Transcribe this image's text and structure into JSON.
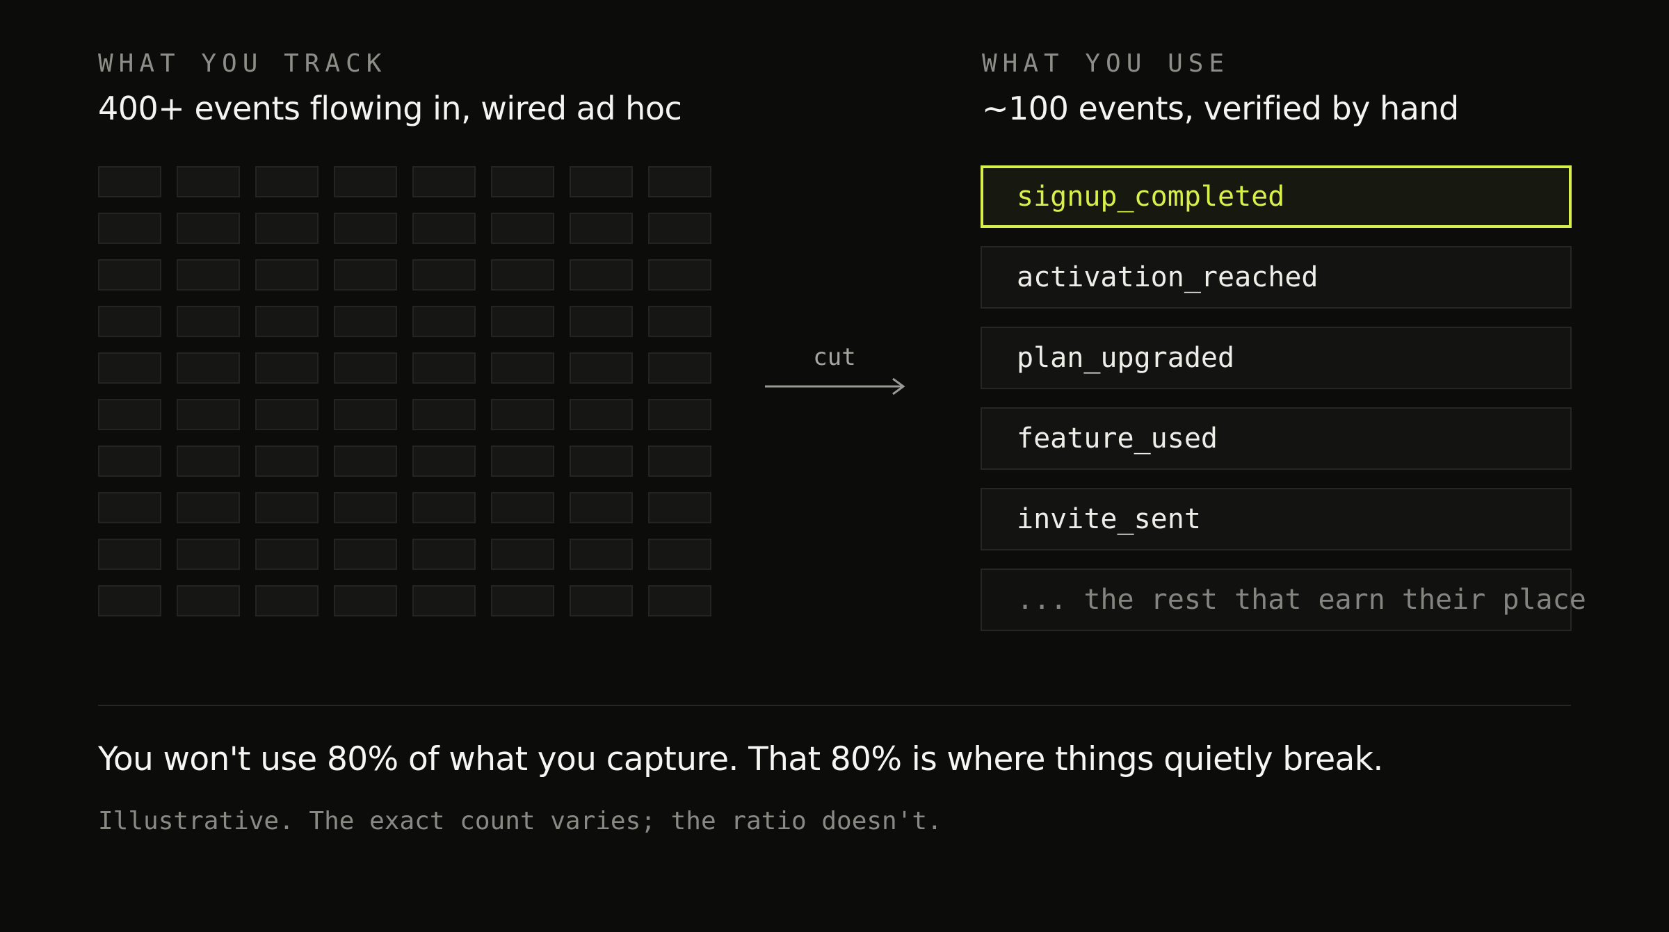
{
  "left": {
    "eyebrow": "WHAT YOU TRACK",
    "heading": "400+ events flowing in, wired ad hoc",
    "grid": {
      "rows": 10,
      "columns": 8
    }
  },
  "connector": {
    "label": "cut",
    "icon": "arrow-right-icon"
  },
  "right": {
    "eyebrow": "WHAT YOU USE",
    "heading": "~100 events, verified by hand",
    "events": [
      {
        "label": "signup_completed",
        "highlighted": true
      },
      {
        "label": "activation_reached",
        "highlighted": false
      },
      {
        "label": "plan_upgraded",
        "highlighted": false
      },
      {
        "label": "feature_used",
        "highlighted": false
      },
      {
        "label": "invite_sent",
        "highlighted": false
      },
      {
        "label": "... the rest that earn their place",
        "highlighted": false
      }
    ]
  },
  "conclusion": "You won't use 80% of what you capture. That 80% is where things quietly break.",
  "footnote": "Illustrative. The exact count varies; the ratio doesn't.",
  "colors": {
    "background": "#0c0c0b",
    "accent": "#d9f04a",
    "muted": "#8e8e88"
  }
}
